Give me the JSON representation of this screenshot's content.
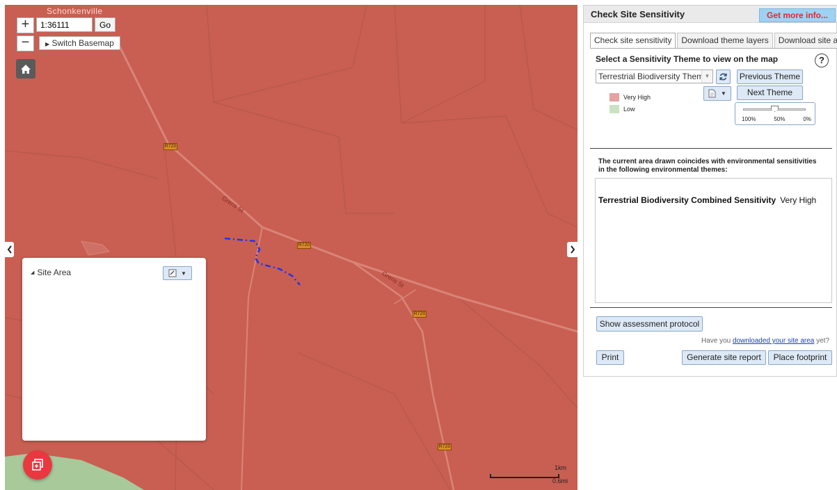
{
  "map": {
    "scale_value": "1:36111",
    "go_label": "Go",
    "zoom_in_label": "+",
    "zoom_out_label": "−",
    "switch_basemap_label": "Switch Basemap",
    "town_label": "Schonkenville",
    "road_labels": [
      "Grens St",
      "Grens St"
    ],
    "route_shields": [
      "R720",
      "R720",
      "R720",
      "R720"
    ],
    "scalebar": {
      "km": "1km",
      "mi": "0.6mi"
    },
    "colors": {
      "very_high": "#c85f52",
      "low": "#a8c99a",
      "site_line": "#2233ee"
    }
  },
  "site_panel": {
    "title": "Site Area"
  },
  "panel": {
    "title": "Check Site Sensitivity",
    "more_info": "Get more info...",
    "tabs": [
      {
        "label": "Check site sensitivity",
        "active": true
      },
      {
        "label": "Download theme layers",
        "active": false
      },
      {
        "label": "Download site area",
        "active": false
      }
    ],
    "theme_heading": "Select a Sensitivity Theme to view on the map",
    "help": "?",
    "theme_selected": "Terrestrial Biodiversity Theme",
    "previous_theme": "Previous Theme",
    "next_theme": "Next Theme",
    "legend": [
      {
        "label": "Very High",
        "color": "#e5a2a1"
      },
      {
        "label": "Low",
        "color": "#c9e3c2"
      }
    ],
    "opacity": {
      "value": 0.5,
      "labels": [
        "100%",
        "50%",
        "0%"
      ]
    },
    "coincide_text": "The current area drawn coincides with environmental sensitivities in the following environmental themes:",
    "results": [
      {
        "theme": "Terrestrial Biodiversity Combined Sensitivity",
        "value": "Very High"
      }
    ],
    "show_protocol": "Show assessment protocol",
    "download_prefix": "Have you ",
    "download_link": "downloaded your site area",
    "download_suffix": " yet?",
    "print": "Print",
    "generate_report": "Generate site report",
    "place_footprint": "Place footprint"
  }
}
